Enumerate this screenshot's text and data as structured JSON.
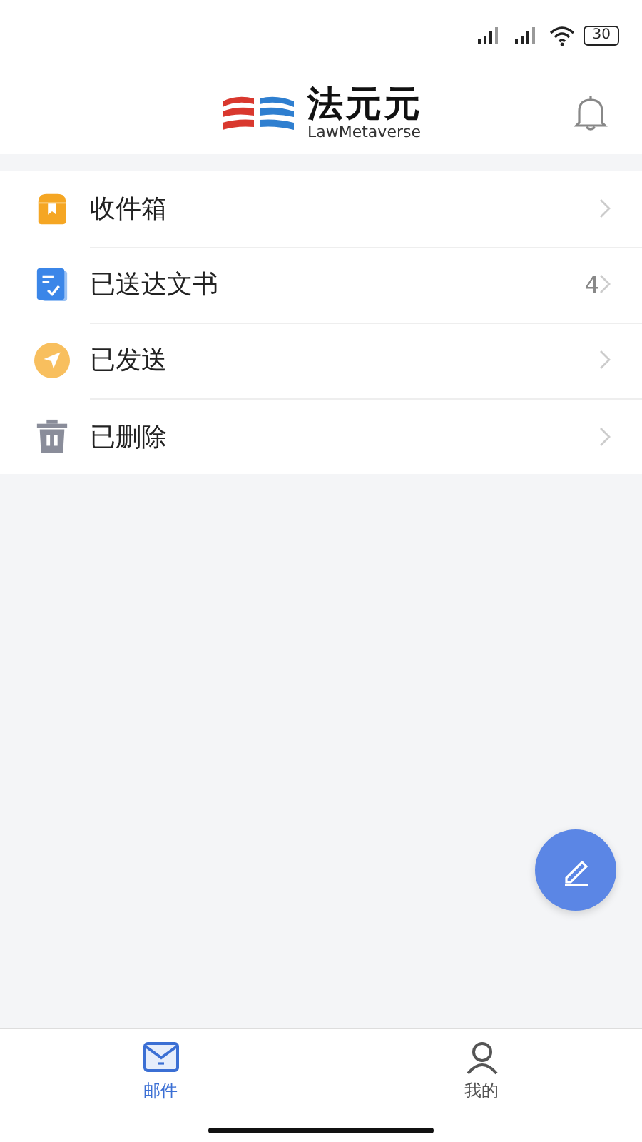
{
  "status_bar": {
    "battery": "30"
  },
  "header": {
    "logo_title": "法元元",
    "logo_subtitle": "LawMetaverse"
  },
  "folders": [
    {
      "kind": "inbox",
      "label": "收件箱"
    },
    {
      "kind": "documents",
      "label": "已送达文书",
      "count": "4"
    },
    {
      "kind": "sent",
      "label": "已发送"
    },
    {
      "kind": "deleted",
      "label": "已删除"
    }
  ],
  "tabs": [
    {
      "kind": "mail",
      "label": "邮件",
      "selected": true
    },
    {
      "kind": "me",
      "label": "我的",
      "selected": false
    }
  ]
}
